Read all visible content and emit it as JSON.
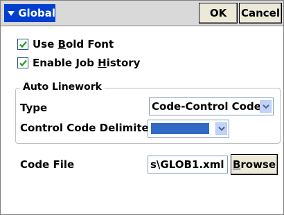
{
  "titlebar": {
    "title": "Global",
    "ok_label": "OK",
    "cancel_label": "Cancel"
  },
  "options": {
    "bold_font": {
      "pre": "Use ",
      "accel": "B",
      "post": "old Font",
      "checked": true
    },
    "job_history": {
      "pre": "Enable Job ",
      "accel": "H",
      "post": "istory",
      "checked": true
    }
  },
  "auto_linework": {
    "group_title": "Auto Linework",
    "type_label": "Type",
    "type_value": "Code-Control Code",
    "delimiter_label": "Control Code Delimite",
    "delimiter_value": ""
  },
  "code_file": {
    "label": "Code File",
    "value": "s\\GLOB1.xml",
    "browse_accel": "B",
    "browse_rest": "rowse"
  },
  "colors": {
    "title_highlight": "#003fd0",
    "selection": "#316ac5",
    "check": "#21a121"
  },
  "icons": {
    "menu": "menu-icon",
    "dropdown": "chevron-down-icon",
    "check": "checkmark-icon"
  }
}
